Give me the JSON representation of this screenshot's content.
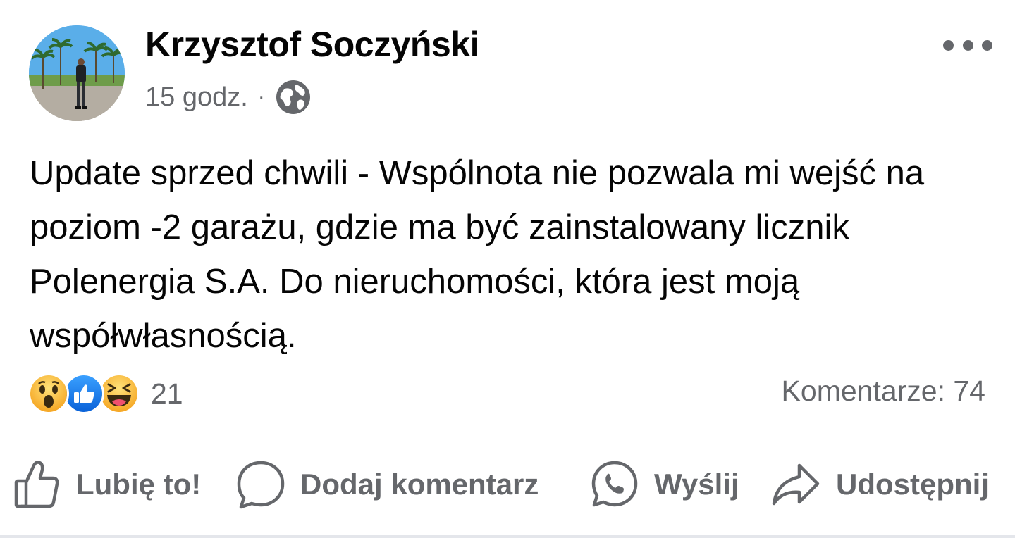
{
  "post": {
    "author": "Krzysztof Soczyński",
    "time": "15 godz.",
    "separator": "·",
    "audience_icon": "globe-icon",
    "text": "Update sprzed chwili - Wspólnota nie pozwala mi wejść na poziom -2 garażu, gdzie ma być zainstalowany licznik Polenergia S.A. Do nieruchomości, która jest moją współwłasnością."
  },
  "reactions": {
    "icons": [
      "wow-reaction-icon",
      "like-reaction-icon",
      "haha-reaction-icon"
    ],
    "count": "21"
  },
  "comments": {
    "label": "Komentarze: 74"
  },
  "actions": {
    "like": "Lubię to!",
    "comment": "Dodaj komentarz",
    "send": "Wyślij",
    "share": "Udostępnij"
  },
  "colors": {
    "text": "#050505",
    "secondary": "#65676b",
    "like_blue": "#1877f2",
    "reaction_yellow": "#f7b928"
  }
}
